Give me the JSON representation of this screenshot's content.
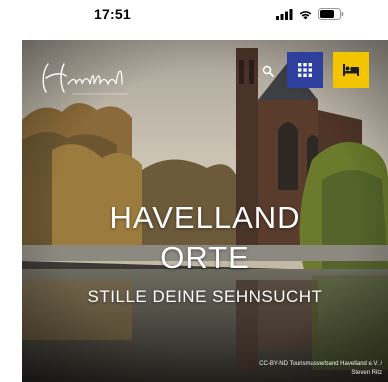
{
  "status_bar": {
    "time": "17:51",
    "icons": [
      "signal-icon",
      "wifi-icon",
      "battery-icon"
    ]
  },
  "header": {
    "logo_text": "Havelland",
    "logo_subtext": "Natürlich. Entschleunigend.",
    "icons": {
      "search": "search-icon",
      "menu": "grid-icon",
      "accommodation": "bed-icon"
    },
    "colors": {
      "menu_button": "#2f3f9e",
      "bed_button": "#f2c500"
    }
  },
  "hero": {
    "title_line1": "HAVELLAND",
    "title_line2": "ORTE",
    "subtitle": "STILLE DEINE SEHNSUCHT",
    "credit_line1": "CC-BY-ND Tourismusverband Havelland e.V. /",
    "credit_line2": "Steven Ritz"
  }
}
